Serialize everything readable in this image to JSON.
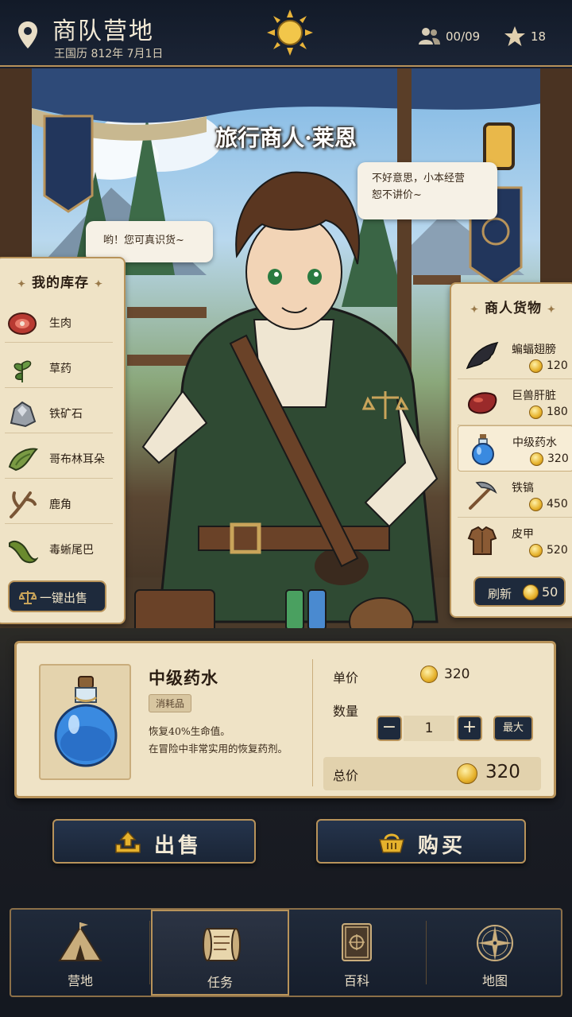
{
  "header": {
    "title": "商队营地",
    "date": "王国历 812年 7月1日",
    "members": "00/09",
    "stars": "18"
  },
  "scene": {
    "merchant_name": "旅行商人·莱恩",
    "bubble_player": "哟！您可真识货~",
    "bubble_merchant_line1": "不好意思，小本经营",
    "bubble_merchant_line2": "恕不讲价~"
  },
  "inventory": {
    "title": "我的库存",
    "items": [
      {
        "label": "生肉",
        "icon": "raw-meat-icon"
      },
      {
        "label": "草药",
        "icon": "herb-icon"
      },
      {
        "label": "铁矿石",
        "icon": "iron-ore-icon"
      },
      {
        "label": "哥布林耳朵",
        "icon": "goblin-ear-icon"
      },
      {
        "label": "鹿角",
        "icon": "antler-icon"
      },
      {
        "label": "毒蜥尾巴",
        "icon": "lizard-tail-icon"
      }
    ],
    "sell_all_label": "一键出售"
  },
  "shop": {
    "title": "商人货物",
    "items": [
      {
        "label": "蝙蝠翅膀",
        "price": "120",
        "icon": "bat-wing-icon"
      },
      {
        "label": "巨兽肝脏",
        "price": "180",
        "icon": "beast-liver-icon"
      },
      {
        "label": "中级药水",
        "price": "320",
        "icon": "potion-icon",
        "selected": true
      },
      {
        "label": "铁镐",
        "price": "450",
        "icon": "pickaxe-icon"
      },
      {
        "label": "皮甲",
        "price": "520",
        "icon": "leather-armor-icon"
      }
    ],
    "refresh_label": "刷新",
    "refresh_cost": "50"
  },
  "detail": {
    "name": "中级药水",
    "tag": "消耗品",
    "desc_line1": "恢复40%生命值。",
    "desc_line2": "在冒险中非常实用的恢复药剂。",
    "price_label": "单价",
    "unit_price": "320",
    "qty_label": "数量",
    "qty_minus": "−",
    "qty": "1",
    "qty_plus": "+",
    "qty_max": "最大",
    "total_label": "总价",
    "total": "320"
  },
  "actions": {
    "sell": "出售",
    "buy": "购买"
  },
  "nav": [
    {
      "label": "营地",
      "icon": "camp-tent-icon"
    },
    {
      "label": "任务",
      "icon": "quest-scroll-icon",
      "active": true
    },
    {
      "label": "百科",
      "icon": "encyclopedia-book-icon"
    },
    {
      "label": "地图",
      "icon": "compass-map-icon"
    }
  ],
  "colors": {
    "gold_border": "#b8935a",
    "parchment": "#efe3c6",
    "navy_button": "#1e2a3c",
    "coin": "#e6b22c"
  }
}
